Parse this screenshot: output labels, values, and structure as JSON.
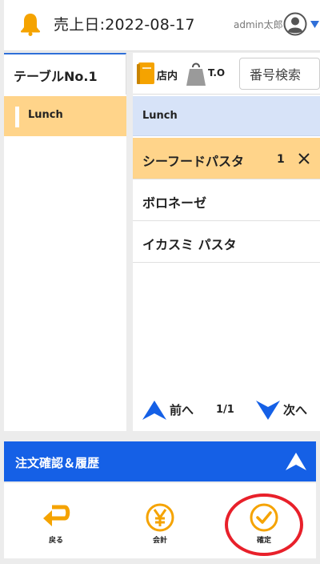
{
  "header": {
    "sales_date": "売上日:2022-08-17",
    "user_label": "admin太郎"
  },
  "left_panel": {
    "table_label": "テーブルNo.1",
    "categories": [
      {
        "label": "Lunch",
        "selected": true
      }
    ]
  },
  "toolbar": {
    "store_label": "店内",
    "takeout_label": "T.O",
    "search_label": "番号検索"
  },
  "menu": {
    "header_label": "Lunch",
    "items": [
      {
        "name": "シーフードパスタ",
        "qty": "1",
        "selected": true
      },
      {
        "name": "ボロネーゼ"
      },
      {
        "name": "イカスミ パスタ"
      }
    ]
  },
  "pager": {
    "prev_label": "前へ",
    "count": "1/1",
    "next_label": "次へ"
  },
  "order_bar": {
    "label": "注文確認＆履歴"
  },
  "footer": {
    "back_label": "戻る",
    "checkout_label": "会計",
    "confirm_label": "確定"
  },
  "colors": {
    "accent_orange": "#f5a300",
    "selected_bg": "#ffd48a",
    "primary_blue": "#1560e6",
    "list_header_bg": "#d7e3f8",
    "annotation_red": "#e8202a"
  }
}
